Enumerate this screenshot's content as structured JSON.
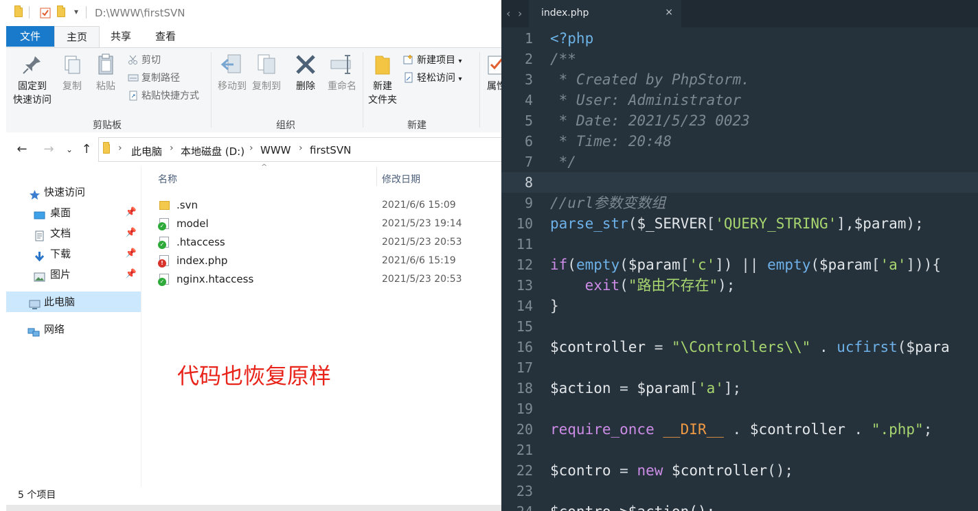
{
  "explorer": {
    "title_path": "D:\\WWW\\firstSVN",
    "tabs": [
      "文件",
      "主页",
      "共享",
      "查看"
    ],
    "ribbon": {
      "pin_label_1": "固定到",
      "pin_label_2": "快速访问",
      "copy": "复制",
      "paste": "粘贴",
      "cut": "剪切",
      "copy_path": "复制路径",
      "paste_shortcut": "粘贴快捷方式",
      "group_clipboard": "剪贴板",
      "move_to": "移动到",
      "copy_to": "复制到",
      "delete": "删除",
      "rename": "重命名",
      "group_organize": "组织",
      "new_folder_1": "新建",
      "new_folder_2": "文件夹",
      "new_item": "新建项目",
      "easy_access": "轻松访问",
      "group_new": "新建",
      "properties": "属性"
    },
    "breadcrumb": [
      "此电脑",
      "本地磁盘 (D:)",
      "WWW",
      "firstSVN"
    ],
    "nav": {
      "quick_access": "快速访问",
      "desktop": "桌面",
      "documents": "文档",
      "downloads": "下载",
      "pictures": "图片",
      "this_pc": "此电脑",
      "network": "网络"
    },
    "columns": {
      "name": "名称",
      "modified": "修改日期"
    },
    "files": [
      {
        "name": ".svn",
        "date": "2021/6/6 15:09",
        "icon": "folder-icon"
      },
      {
        "name": "model",
        "date": "2021/5/23 19:14",
        "icon": "svn-normal-icon"
      },
      {
        "name": ".htaccess",
        "date": "2021/5/23 20:53",
        "icon": "svn-normal-icon"
      },
      {
        "name": "index.php",
        "date": "2021/6/6 15:19",
        "icon": "svn-modified-icon"
      },
      {
        "name": "nginx.htaccess",
        "date": "2021/5/23 20:53",
        "icon": "svn-normal-icon"
      }
    ],
    "annotation": "代码也恢复原样",
    "status": "5 个项目"
  },
  "editor": {
    "tab_title": "index.php",
    "close_glyph": "×",
    "lines": [
      {
        "n": "1",
        "segs": [
          [
            "<?php",
            "php"
          ]
        ]
      },
      {
        "n": "2",
        "segs": [
          [
            "/**",
            "cmt"
          ]
        ]
      },
      {
        "n": "3",
        "segs": [
          [
            " * Created by PhpStorm.",
            "cmt"
          ]
        ]
      },
      {
        "n": "4",
        "segs": [
          [
            " * User: Administrator",
            "cmt"
          ]
        ]
      },
      {
        "n": "5",
        "segs": [
          [
            " * Date: 2021/5/23 0023",
            "cmt"
          ]
        ]
      },
      {
        "n": "6",
        "segs": [
          [
            " * Time: 20:48",
            "cmt"
          ]
        ]
      },
      {
        "n": "7",
        "segs": [
          [
            " */",
            "cmt"
          ]
        ]
      },
      {
        "n": "8",
        "segs": [],
        "current": true
      },
      {
        "n": "9",
        "segs": [
          [
            "//url参数变数组",
            "cmt"
          ]
        ]
      },
      {
        "n": "10",
        "segs": [
          [
            "parse_str",
            "fn"
          ],
          [
            "(",
            "op"
          ],
          [
            "$_SERVER",
            "var"
          ],
          [
            "[",
            "op"
          ],
          [
            "'QUERY_STRING'",
            "str"
          ],
          [
            "],",
            "op"
          ],
          [
            "$param",
            "var"
          ],
          [
            ");",
            "op"
          ]
        ]
      },
      {
        "n": "11",
        "segs": []
      },
      {
        "n": "12",
        "segs": [
          [
            "if",
            "kw"
          ],
          [
            "(",
            "op"
          ],
          [
            "empty",
            "fn"
          ],
          [
            "(",
            "op"
          ],
          [
            "$param",
            "var"
          ],
          [
            "[",
            "op"
          ],
          [
            "'c'",
            "str"
          ],
          [
            "]) || ",
            "op"
          ],
          [
            "empty",
            "fn"
          ],
          [
            "(",
            "op"
          ],
          [
            "$param",
            "var"
          ],
          [
            "[",
            "op"
          ],
          [
            "'a'",
            "str"
          ],
          [
            "])){",
            "op"
          ]
        ]
      },
      {
        "n": "13",
        "segs": [
          [
            "    exit",
            "kw"
          ],
          [
            "(",
            "op"
          ],
          [
            "\"路由不存在\"",
            "str"
          ],
          [
            ");",
            "op"
          ]
        ]
      },
      {
        "n": "14",
        "segs": [
          [
            "}",
            "op"
          ]
        ]
      },
      {
        "n": "15",
        "segs": []
      },
      {
        "n": "16",
        "segs": [
          [
            "$controller",
            "var"
          ],
          [
            " = ",
            "op"
          ],
          [
            "\"\\Controllers\\\\\"",
            "str"
          ],
          [
            " . ",
            "op"
          ],
          [
            "ucfirst",
            "fn"
          ],
          [
            "(",
            "op"
          ],
          [
            "$para",
            "var"
          ]
        ]
      },
      {
        "n": "17",
        "segs": []
      },
      {
        "n": "18",
        "segs": [
          [
            "$action",
            "var"
          ],
          [
            " = ",
            "op"
          ],
          [
            "$param",
            "var"
          ],
          [
            "[",
            "op"
          ],
          [
            "'a'",
            "str"
          ],
          [
            "];",
            "op"
          ]
        ]
      },
      {
        "n": "19",
        "segs": []
      },
      {
        "n": "20",
        "segs": [
          [
            "require_once",
            "kw"
          ],
          [
            " ",
            "op"
          ],
          [
            "__DIR__",
            "const"
          ],
          [
            " . ",
            "op"
          ],
          [
            "$controller",
            "var"
          ],
          [
            " . ",
            "op"
          ],
          [
            "\".php\"",
            "str"
          ],
          [
            ";",
            "op"
          ]
        ]
      },
      {
        "n": "21",
        "segs": []
      },
      {
        "n": "22",
        "segs": [
          [
            "$contro",
            "var"
          ],
          [
            " = ",
            "op"
          ],
          [
            "new",
            "kw"
          ],
          [
            " ",
            "op"
          ],
          [
            "$controller",
            "var"
          ],
          [
            "();",
            "op"
          ]
        ]
      },
      {
        "n": "23",
        "segs": []
      },
      {
        "n": "24",
        "segs": [
          [
            "$contro->$action();",
            "var"
          ]
        ]
      }
    ]
  },
  "colors": {
    "ribbon_file_tab": "#1979ca",
    "annotation": "#e8241a",
    "editor_bg": "#25323c",
    "selected_nav": "#cce8ff"
  }
}
